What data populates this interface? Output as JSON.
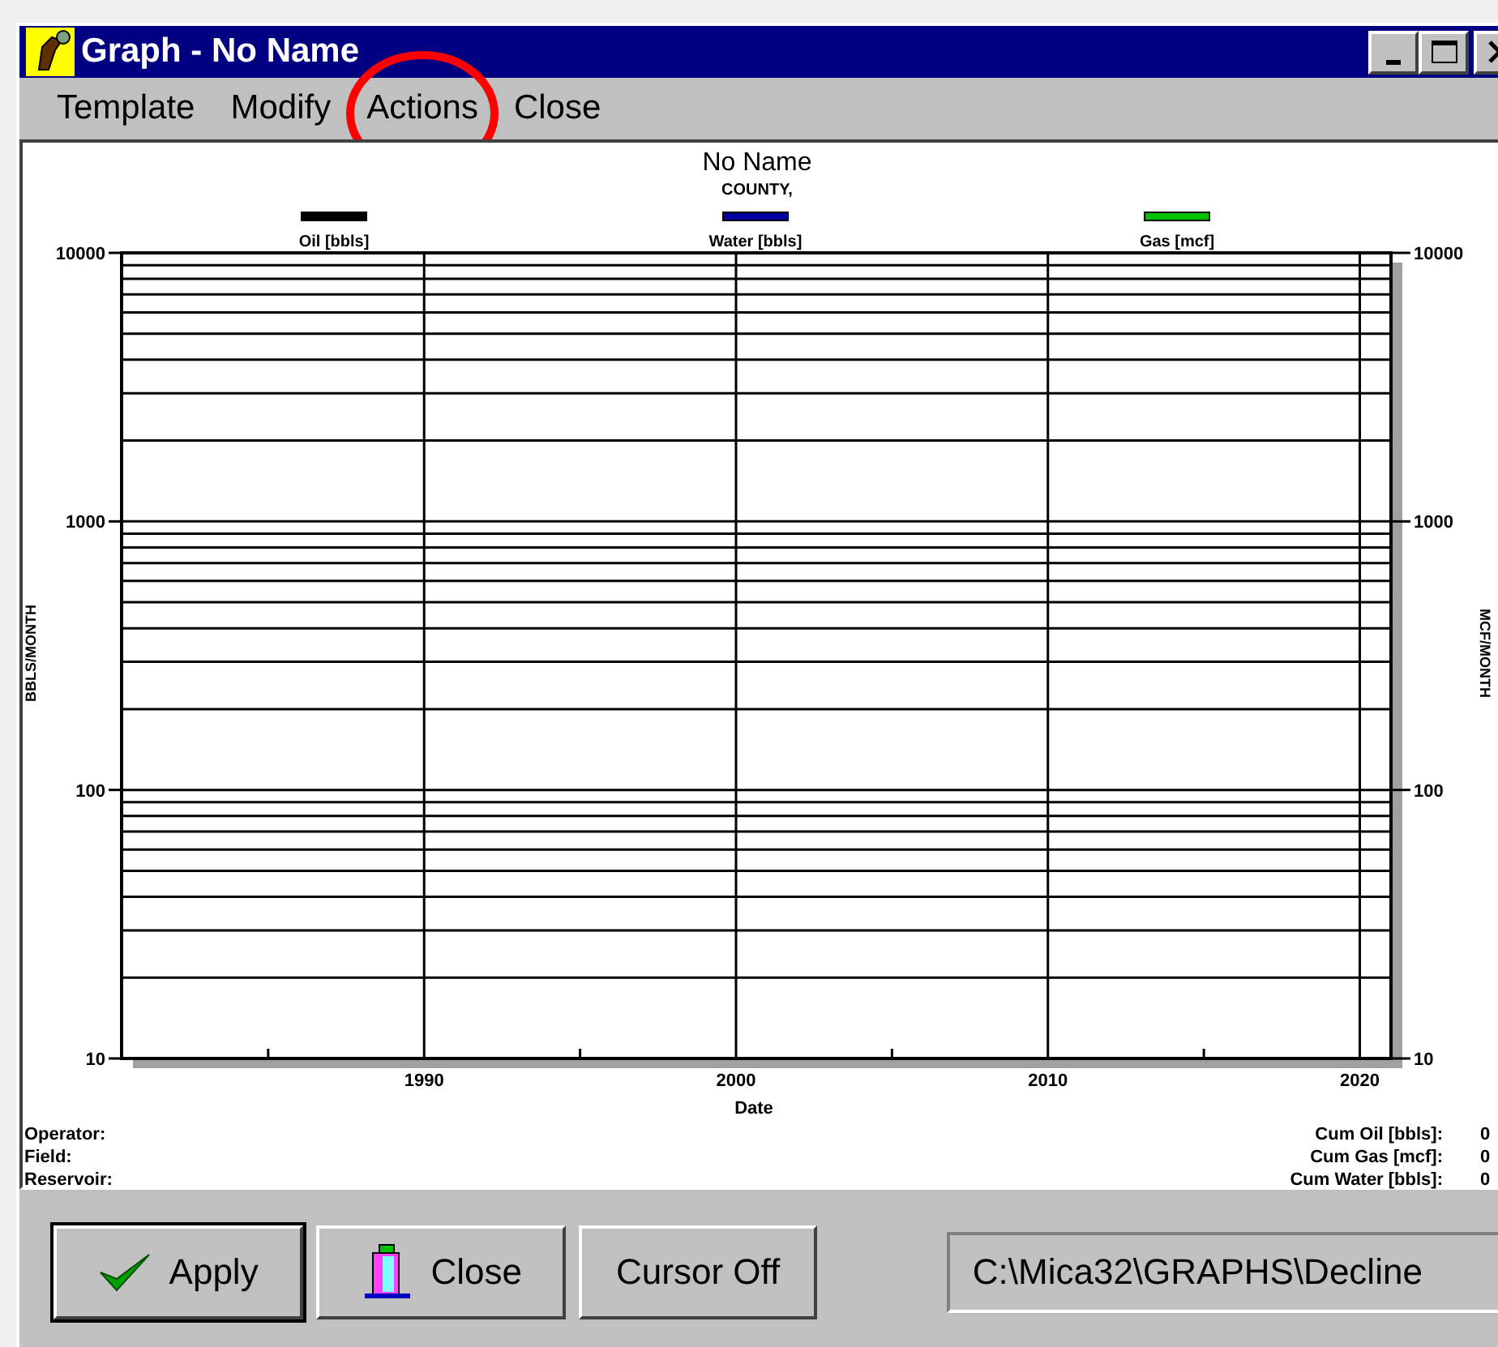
{
  "window": {
    "title": "Graph - No Name"
  },
  "window_controls": [
    {
      "kind": "minimize"
    },
    {
      "kind": "maximize"
    },
    {
      "kind": "close"
    }
  ],
  "menu": [
    {
      "label": "Template",
      "circled": false
    },
    {
      "label": "Modify",
      "circled": false
    },
    {
      "label": "Actions",
      "circled": true
    },
    {
      "label": "Close",
      "circled": false
    }
  ],
  "graph": {
    "title": "No Name",
    "subtitle": "COUNTY,",
    "legend": [
      {
        "label": "Oil [bbls]",
        "color": "#000000"
      },
      {
        "label": "Water [bbls]",
        "color": "#0000a0"
      },
      {
        "label": "Gas [mcf]",
        "color": "#00c000"
      }
    ],
    "left_axis_labels": [
      "10000",
      "1000",
      "100",
      "10"
    ],
    "right_axis_labels": [
      "10000",
      "1000",
      "100",
      "10"
    ],
    "x_axis_labels": [
      "1990",
      "2000",
      "2010",
      "2020"
    ],
    "xlabel": "Date",
    "ylabel": "BBLS/MONTH",
    "right_ylabel": "MCF/MONTH"
  },
  "info_left": [
    {
      "label": "Operator:"
    },
    {
      "label": "Field:"
    },
    {
      "label": "Reservoir:"
    }
  ],
  "info_right": [
    {
      "label": "Cum Oil [bbls]:",
      "value": "0"
    },
    {
      "label": "Cum Gas [mcf]:",
      "value": "0"
    },
    {
      "label": "Cum Water [bbls]:",
      "value": "0"
    }
  ],
  "buttons": [
    {
      "label": "Apply",
      "kind": "apply"
    },
    {
      "label": "Close",
      "kind": "close"
    },
    {
      "label": "Cursor Off",
      "kind": "plain"
    }
  ],
  "path_field": {
    "value": "C:\\Mica32\\GRAPHS\\Decline"
  }
}
